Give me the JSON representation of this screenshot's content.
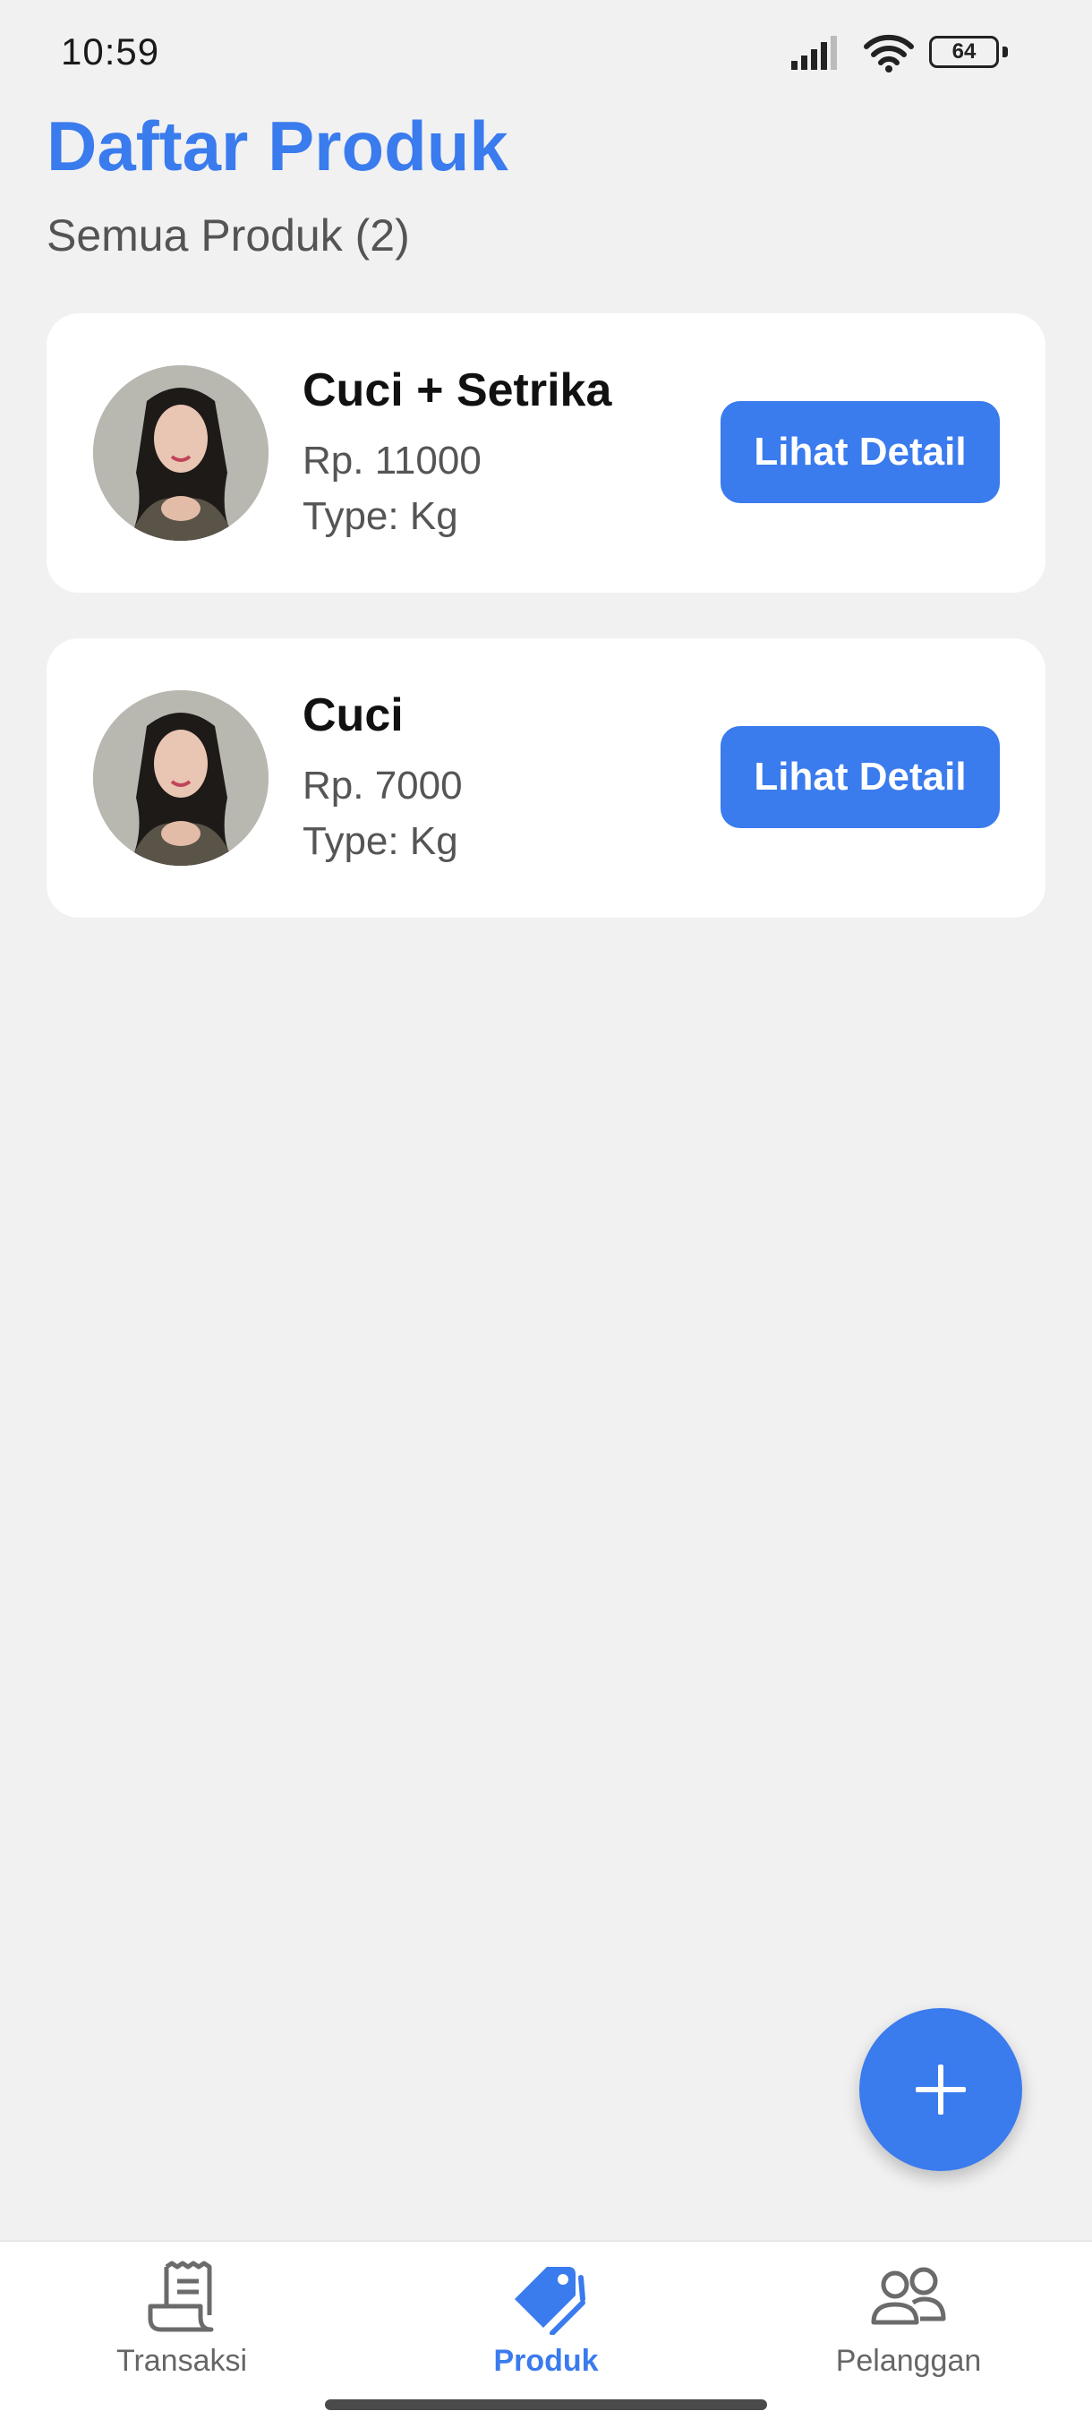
{
  "status_bar": {
    "time": "10:59",
    "battery": "64",
    "icons": [
      "signal-icon",
      "wifi-icon",
      "battery-icon"
    ]
  },
  "header": {
    "title": "Daftar Produk",
    "subtitle": "Semua Produk (2)"
  },
  "products": [
    {
      "name": "Cuci + Setrika",
      "price": "Rp. 11000",
      "type": "Type: Kg",
      "button_label": "Lihat Detail"
    },
    {
      "name": "Cuci",
      "price": "Rp. 7000",
      "type": "Type: Kg",
      "button_label": "Lihat Detail"
    }
  ],
  "fab": {
    "icon": "plus-icon"
  },
  "bottom_nav": {
    "items": [
      {
        "label": "Transaksi",
        "icon": "receipt-icon"
      },
      {
        "label": "Produk",
        "icon": "tag-icon",
        "active": true
      },
      {
        "label": "Pelanggan",
        "icon": "users-icon"
      }
    ]
  },
  "colors": {
    "accent": "#3a7bed",
    "background": "#f1f1f2",
    "card": "#ffffff"
  }
}
